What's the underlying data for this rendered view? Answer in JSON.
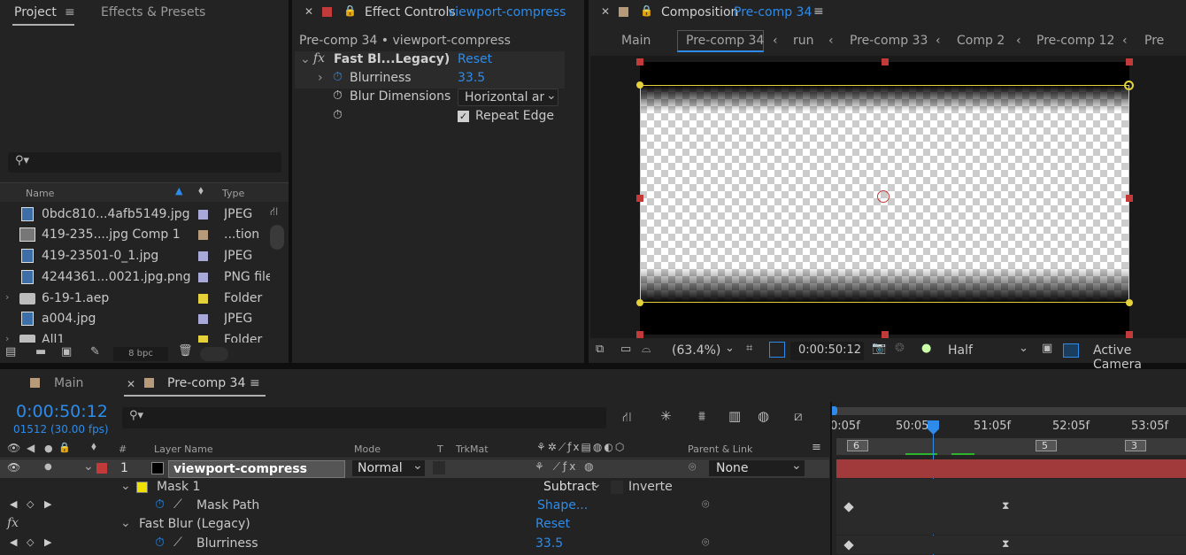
{
  "project_panel": {
    "tab_project": "Project",
    "tab_effects": "Effects & Presets",
    "search_placeholder": "",
    "col_name": "Name",
    "col_type": "Type",
    "items": [
      {
        "name": "0bdc810...4afb5149.jpg",
        "type": "JPEG",
        "label_color": "#a9a9d9",
        "kind": "image",
        "expandable": false
      },
      {
        "name": "419-235....jpg Comp 1",
        "type": "...tion",
        "label_color": "#b79a7a",
        "kind": "comp",
        "expandable": false
      },
      {
        "name": "419-23501-0_1.jpg",
        "type": "JPEG",
        "label_color": "#a9a9d9",
        "kind": "image",
        "expandable": false
      },
      {
        "name": "4244361...0021.jpg.png",
        "type": "PNG file",
        "label_color": "#a9a9d9",
        "kind": "image",
        "expandable": false
      },
      {
        "name": "6-19-1.aep",
        "type": "Folder",
        "label_color": "#e5d23a",
        "kind": "folder",
        "expandable": true
      },
      {
        "name": "a004.jpg",
        "type": "JPEG",
        "label_color": "#a9a9d9",
        "kind": "image",
        "expandable": false
      },
      {
        "name": "All1",
        "type": "Folder",
        "label_color": "#e5d23a",
        "kind": "folder",
        "expandable": true
      }
    ],
    "bpc": "8 bpc"
  },
  "effect_controls": {
    "title": "Effect Controls",
    "layer_name": "viewport-compress",
    "breadcrumb": "Pre-comp 34 • viewport-compress",
    "effect_name": "Fast Bl...Legacy)",
    "reset": "Reset",
    "blurriness_label": "Blurriness",
    "blurriness_value": "33.5",
    "blur_dim_label": "Blur Dimensions",
    "blur_dim_value": "Horizontal and",
    "repeat_edge": "Repeat Edge"
  },
  "composition": {
    "title": "Composition",
    "comp_name": "Pre-comp 34",
    "breadcrumbs": [
      "Main",
      "Pre-comp 34",
      "run",
      "Pre-comp 33",
      "Comp 2",
      "Pre-comp 12",
      "Pre"
    ],
    "zoom": "(63.4%)",
    "timecode": "0:00:50:12",
    "resolution": "Half",
    "camera": "Active Camera"
  },
  "timeline": {
    "tab_main": "Main",
    "tab_precomp": "Pre-comp 34",
    "timecode": "0:00:50:12",
    "frames": "01512 (30.00 fps)",
    "search_placeholder": "",
    "col_hash": "#",
    "col_layer_name": "Layer Name",
    "col_mode": "Mode",
    "col_t": "T",
    "col_trkmat": "TrkMat",
    "col_parent": "Parent & Link",
    "ruler_ticks": [
      "0:05f",
      "50:05f",
      "51:05f",
      "52:05f",
      "53:05f"
    ],
    "markers": [
      "6",
      "5",
      "3"
    ],
    "layer": {
      "index": "1",
      "name": "viewport-compress",
      "mode": "Normal",
      "parent": "None",
      "label_color": "#c23a3a"
    },
    "mask_label": "Mask 1",
    "mask_mode": "Subtract",
    "mask_inverted": "Inverte",
    "mask_path_label": "Mask Path",
    "mask_path_value": "Shape...",
    "effect_label": "Fast Blur (Legacy)",
    "effect_reset": "Reset",
    "blurriness_label": "Blurriness",
    "blurriness_value": "33.5",
    "fx_symbol": "fx"
  }
}
